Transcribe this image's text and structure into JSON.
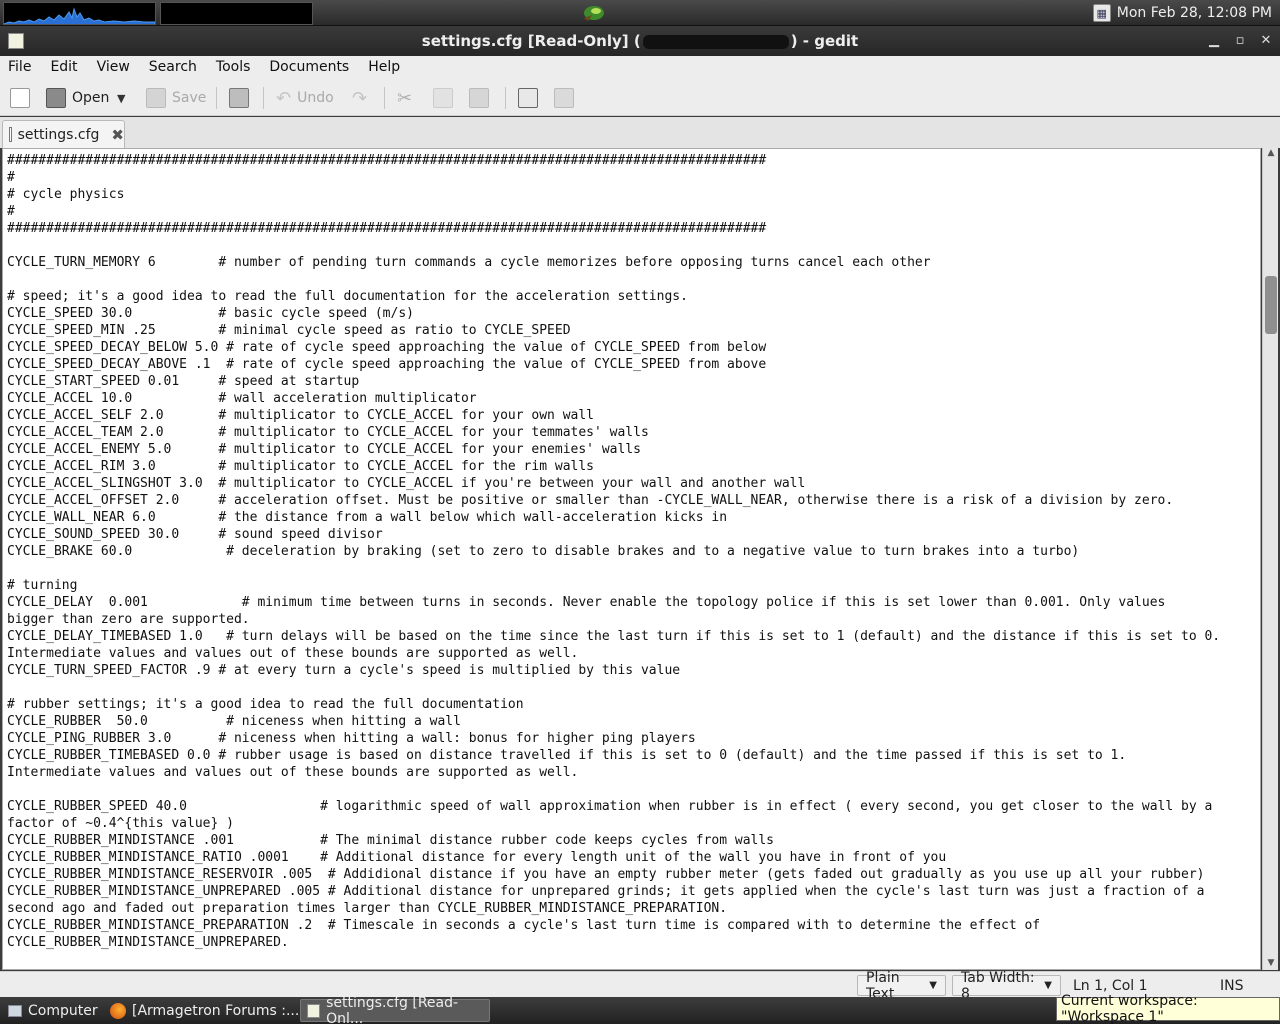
{
  "top_panel": {
    "clock": "Mon Feb 28, 12:08 PM"
  },
  "window": {
    "title_prefix": "settings.cfg [Read-Only] (",
    "title_suffix": ") - gedit"
  },
  "menubar": {
    "items": [
      "File",
      "Edit",
      "View",
      "Search",
      "Tools",
      "Documents",
      "Help"
    ]
  },
  "toolbar": {
    "open_label": "Open",
    "save_label": "Save",
    "undo_label": "Undo"
  },
  "tab": {
    "label": "settings.cfg"
  },
  "editor": {
    "lines": [
      "#################################################################################################",
      "#",
      "# cycle physics",
      "#",
      "#################################################################################################",
      "",
      "CYCLE_TURN_MEMORY 6        # number of pending turn commands a cycle memorizes before opposing turns cancel each other",
      "",
      "# speed; it's a good idea to read the full documentation for the acceleration settings.",
      "CYCLE_SPEED 30.0           # basic cycle speed (m/s)",
      "CYCLE_SPEED_MIN .25        # minimal cycle speed as ratio to CYCLE_SPEED",
      "CYCLE_SPEED_DECAY_BELOW 5.0 # rate of cycle speed approaching the value of CYCLE_SPEED from below",
      "CYCLE_SPEED_DECAY_ABOVE .1  # rate of cycle speed approaching the value of CYCLE_SPEED from above",
      "CYCLE_START_SPEED 0.01     # speed at startup",
      "CYCLE_ACCEL 10.0           # wall acceleration multiplicator",
      "CYCLE_ACCEL_SELF 2.0       # multiplicator to CYCLE_ACCEL for your own wall",
      "CYCLE_ACCEL_TEAM 2.0       # multiplicator to CYCLE_ACCEL for your temmates' walls",
      "CYCLE_ACCEL_ENEMY 5.0      # multiplicator to CYCLE_ACCEL for your enemies' walls",
      "CYCLE_ACCEL_RIM 3.0        # multiplicator to CYCLE_ACCEL for the rim walls",
      "CYCLE_ACCEL_SLINGSHOT 3.0  # multiplicator to CYCLE_ACCEL if you're between your wall and another wall",
      "CYCLE_ACCEL_OFFSET 2.0     # acceleration offset. Must be positive or smaller than -CYCLE_WALL_NEAR, otherwise there is a risk of a division by zero.",
      "CYCLE_WALL_NEAR 6.0        # the distance from a wall below which wall-acceleration kicks in",
      "CYCLE_SOUND_SPEED 30.0     # sound speed divisor",
      "CYCLE_BRAKE 60.0            # deceleration by braking (set to zero to disable brakes and to a negative value to turn brakes into a turbo)",
      "",
      "# turning",
      "CYCLE_DELAY  0.001            # minimum time between turns in seconds. Never enable the topology police if this is set lower than 0.001. Only values",
      "bigger than zero are supported.",
      "CYCLE_DELAY_TIMEBASED 1.0   # turn delays will be based on the time since the last turn if this is set to 1 (default) and the distance if this is set to 0.",
      "Intermediate values and values out of these bounds are supported as well.",
      "CYCLE_TURN_SPEED_FACTOR .9 # at every turn a cycle's speed is multiplied by this value",
      "",
      "# rubber settings; it's a good idea to read the full documentation",
      "CYCLE_RUBBER  50.0          # niceness when hitting a wall",
      "CYCLE_PING_RUBBER 3.0      # niceness when hitting a wall: bonus for higher ping players",
      "CYCLE_RUBBER_TIMEBASED 0.0 # rubber usage is based on distance travelled if this is set to 0 (default) and the time passed if this is set to 1.",
      "Intermediate values and values out of these bounds are supported as well.",
      "",
      "CYCLE_RUBBER_SPEED 40.0                 # logarithmic speed of wall approximation when rubber is in effect ( every second, you get closer to the wall by a",
      "factor of ~0.4^{this value} )",
      "CYCLE_RUBBER_MINDISTANCE .001           # The minimal distance rubber code keeps cycles from walls",
      "CYCLE_RUBBER_MINDISTANCE_RATIO .0001    # Additional distance for every length unit of the wall you have in front of you",
      "CYCLE_RUBBER_MINDISTANCE_RESERVOIR .005  # Addidional distance if you have an empty rubber meter (gets faded out gradually as you use up all your rubber)",
      "CYCLE_RUBBER_MINDISTANCE_UNPREPARED .005 # Additional distance for unprepared grinds; it gets applied when the cycle's last turn was just a fraction of a",
      "second ago and faded out preparation times larger than CYCLE_RUBBER_MINDISTANCE_PREPARATION.",
      "CYCLE_RUBBER_MINDISTANCE_PREPARATION .2  # Timescale in seconds a cycle's last turn time is compared with to determine the effect of",
      "CYCLE_RUBBER_MINDISTANCE_UNPREPARED."
    ]
  },
  "statusbar": {
    "language": "Plain Text",
    "tab_width": "Tab Width: 8",
    "position": "Ln 1, Col 1",
    "mode": "INS"
  },
  "taskbar": {
    "computer": "Computer",
    "firefox": "[Armagetron Forums :...",
    "gedit": "settings.cfg [Read-Onl..."
  },
  "tooltip": {
    "workspace": "Current workspace: \"Workspace 1\""
  },
  "colors": {
    "panel": "#2e2e2e",
    "editor_bg": "#ffffff",
    "cpu_graph": "#2a6fd6"
  }
}
